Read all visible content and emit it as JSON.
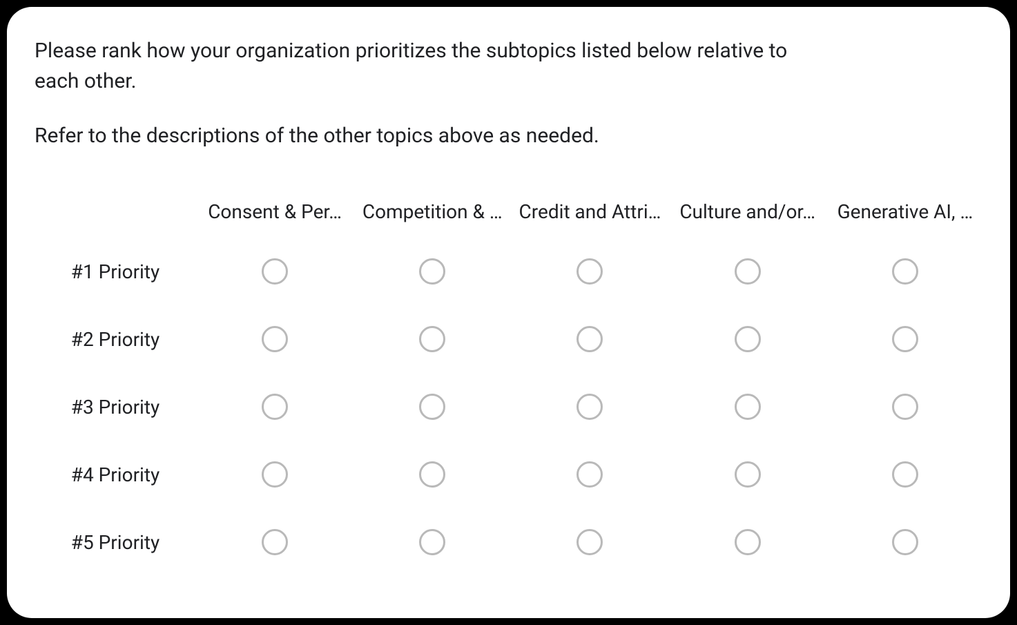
{
  "question": {
    "line1": "Please rank how your organization prioritizes the subtopics listed below relative to each other.",
    "line2": "Refer to the descriptions of the other topics above as needed."
  },
  "columns": [
    "Consent & Per…",
    "Competition & …",
    "Credit and Attri…",
    "Culture and/or…",
    "Generative AI, …"
  ],
  "rows": [
    "#1 Priority",
    "#2 Priority",
    "#3 Priority",
    "#4 Priority",
    "#5 Priority"
  ]
}
